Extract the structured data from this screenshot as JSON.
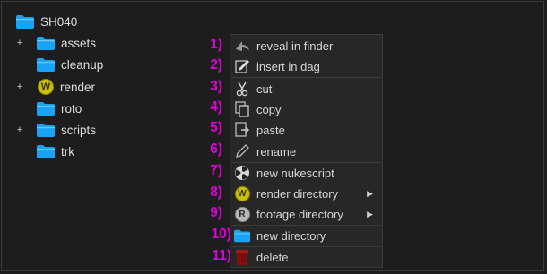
{
  "tree": {
    "root": {
      "label": "SH040",
      "icon": "folder-icon"
    },
    "children": [
      {
        "label": "assets",
        "icon": "folder-icon",
        "expandable": true
      },
      {
        "label": "cleanup",
        "icon": "folder-icon",
        "expandable": false
      },
      {
        "label": "render",
        "icon": "render-w-icon",
        "expandable": true
      },
      {
        "label": "roto",
        "icon": "folder-icon",
        "expandable": false
      },
      {
        "label": "scripts",
        "icon": "folder-icon",
        "expandable": true
      },
      {
        "label": "trk",
        "icon": "folder-icon",
        "expandable": false
      }
    ],
    "expander_glyph": "+"
  },
  "render_badge": "W",
  "footage_badge": "R",
  "submenu_arrow": "▶",
  "context_menu": {
    "items": [
      {
        "number": "1)",
        "label": "reveal in finder",
        "icon": "reveal-arrow-icon"
      },
      {
        "number": "2)",
        "label": "insert in dag",
        "icon": "insert-edit-icon"
      },
      {
        "number": "3)",
        "label": "cut",
        "icon": "scissors-icon"
      },
      {
        "number": "4)",
        "label": "copy",
        "icon": "copy-icon"
      },
      {
        "number": "5)",
        "label": "paste",
        "icon": "paste-icon"
      },
      {
        "number": "6)",
        "label": "rename",
        "icon": "pencil-icon"
      },
      {
        "number": "7)",
        "label": "new nukescript",
        "icon": "nuke-icon"
      },
      {
        "number": "8)",
        "label": "render directory",
        "icon": "render-w-icon",
        "submenu": true
      },
      {
        "number": "9)",
        "label": "footage directory",
        "icon": "footage-r-icon",
        "submenu": true
      },
      {
        "number": "10)",
        "label": "new directory",
        "icon": "folder-icon"
      },
      {
        "number": "11)",
        "label": "delete",
        "icon": "trash-icon"
      }
    ]
  },
  "colors": {
    "background": "#1d1d1d",
    "menu_background": "#272727",
    "annotation_magenta": "#e000d8",
    "folder_blue": "#1aa3f5",
    "render_yellow": "#c9c100",
    "delete_red": "#8a1010"
  }
}
